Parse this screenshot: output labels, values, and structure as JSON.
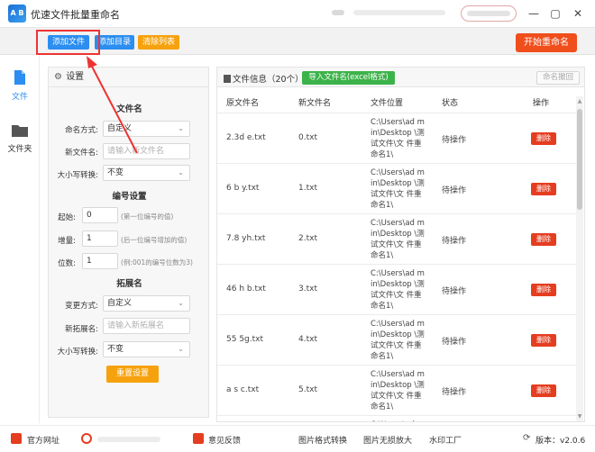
{
  "window": {
    "title": "优速文件批量重命名",
    "logo_text": "A B",
    "minimize": "—",
    "maximize": "▢",
    "close": "✕"
  },
  "toolbar": {
    "add_file": "添加文件",
    "add_folder": "添加目录",
    "clear_list": "清除列表",
    "start_rename": "开始重命名"
  },
  "rail": {
    "file": "文件",
    "folder": "文件夹"
  },
  "settings": {
    "title": "设置",
    "filename_section": "文件名",
    "naming_mode_label": "命名方式:",
    "naming_mode_value": "自定义",
    "new_name_label": "新文件名:",
    "new_name_placeholder": "请输入新文件名",
    "case_label": "大小写转换:",
    "case_value": "不变",
    "number_section": "编号设置",
    "start_label": "起始:",
    "start_value": "0",
    "start_hint": "(第一位编号的值)",
    "step_label": "增量:",
    "step_value": "1",
    "step_hint": "(后一位编号增加的值)",
    "digits_label": "位数:",
    "digits_value": "1",
    "digits_hint": "(例:001的编号位数为3)",
    "ext_section": "拓展名",
    "ext_mode_label": "变更方式:",
    "ext_mode_value": "自定义",
    "new_ext_label": "新拓展名:",
    "new_ext_placeholder": "请输入新拓展名",
    "ext_case_label": "大小写转换:",
    "ext_case_value": "不变",
    "reset": "重置设置"
  },
  "filelist": {
    "title": "文件信息（20个）",
    "import_btn": "导入文件名(excel格式)",
    "restore_btn": "命名撤回",
    "columns": [
      "原文件名",
      "新文件名",
      "文件位置",
      "状态",
      "操作"
    ],
    "rows": [
      {
        "orig": "2.3d e.txt",
        "new": "0.txt",
        "loc": "C:\\Users\\ad min\\Desktop \\测试文件\\文 件重命名1\\",
        "status": "待操作",
        "action": "删除"
      },
      {
        "orig": "6 b y.txt",
        "new": "1.txt",
        "loc": "C:\\Users\\ad min\\Desktop \\测试文件\\文 件重命名1\\",
        "status": "待操作",
        "action": "删除"
      },
      {
        "orig": "7.8 yh.txt",
        "new": "2.txt",
        "loc": "C:\\Users\\ad min\\Desktop \\测试文件\\文 件重命名1\\",
        "status": "待操作",
        "action": "删除"
      },
      {
        "orig": "46 h b.txt",
        "new": "3.txt",
        "loc": "C:\\Users\\ad min\\Desktop \\测试文件\\文 件重命名1\\",
        "status": "待操作",
        "action": "删除"
      },
      {
        "orig": "55 5g.txt",
        "new": "4.txt",
        "loc": "C:\\Users\\ad min\\Desktop \\测试文件\\文 件重命名1\\",
        "status": "待操作",
        "action": "删除"
      },
      {
        "orig": "a s c.txt",
        "new": "5.txt",
        "loc": "C:\\Users\\ad min\\Desktop \\测试文件\\文 件重命名1\\",
        "status": "待操作",
        "action": "删除"
      },
      {
        "orig": "",
        "new": "",
        "loc": "C:\\Users\\ad",
        "status": "",
        "action": ""
      }
    ]
  },
  "statusbar": {
    "website": "官方网址",
    "feedback": "意见反馈",
    "convert": "图片格式转换",
    "enlarge": "图片无损放大",
    "watermark": "水印工厂",
    "version": "版本：v2.0.6"
  },
  "colors": {
    "blue": "#2b8ef0",
    "orange": "#f6a20f",
    "red": "#f04e1b",
    "green": "#3cb34a",
    "highlight": "#ee3333"
  }
}
